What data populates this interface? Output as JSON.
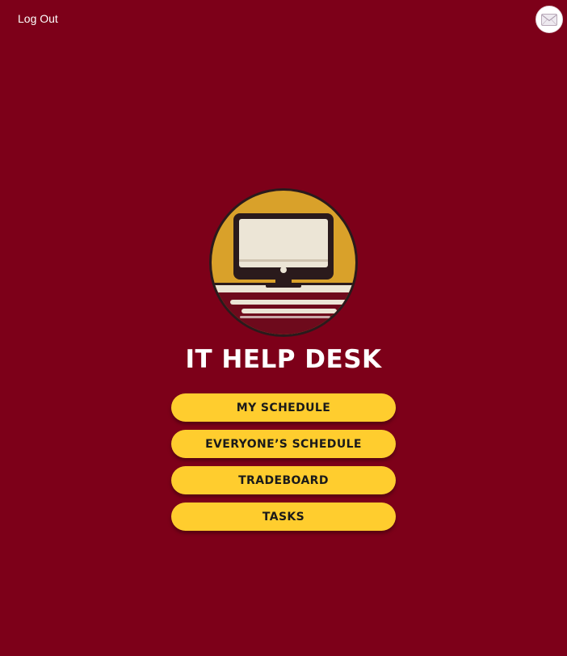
{
  "header": {
    "logout_label": "Log Out",
    "mail_icon": "envelope-icon"
  },
  "logo": {
    "icon": "computer-monitor-icon",
    "colors": {
      "circle": "#d9a12a",
      "ring": "#2a1a1c",
      "screen": "#ece5d6",
      "base": "#6e0a1c"
    }
  },
  "title": "IT HELP DESK",
  "menu": {
    "items": [
      {
        "label": "MY SCHEDULE"
      },
      {
        "label": "EVERYONE’S SCHEDULE"
      },
      {
        "label": "TRADEBOARD"
      },
      {
        "label": "TASKS"
      }
    ]
  },
  "colors": {
    "background": "#7d0019",
    "button": "#ffcd2e",
    "button_text": "#1a1a1a",
    "title_text": "#ffffff"
  }
}
